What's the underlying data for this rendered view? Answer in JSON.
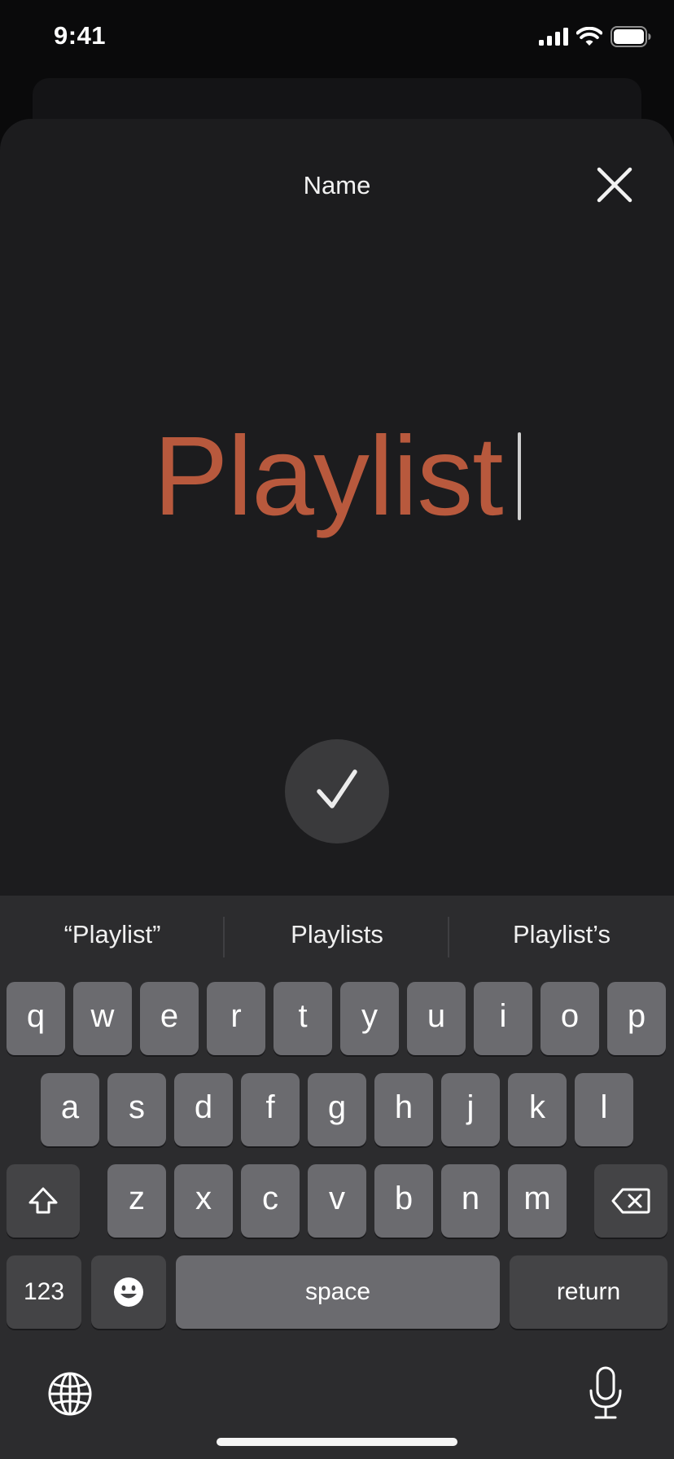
{
  "status_bar": {
    "time": "9:41",
    "icons": [
      "cellular-signal-icon",
      "wifi-icon",
      "battery-icon"
    ]
  },
  "sheet": {
    "title": "Name",
    "close_icon": "close-icon",
    "name_value": "Playlist",
    "confirm_icon": "checkmark-icon"
  },
  "colors": {
    "accent": "#b8593d",
    "sheet_bg": "#1c1c1e",
    "keyboard_bg": "#2c2c2e",
    "key_bg": "#6b6b6f",
    "key_dark_bg": "#444446"
  },
  "keyboard": {
    "suggestions": [
      "“Playlist”",
      "Playlists",
      "Playlist’s"
    ],
    "row1": [
      "q",
      "w",
      "e",
      "r",
      "t",
      "y",
      "u",
      "i",
      "o",
      "p"
    ],
    "row2": [
      "a",
      "s",
      "d",
      "f",
      "g",
      "h",
      "j",
      "k",
      "l"
    ],
    "row3": [
      "z",
      "x",
      "c",
      "v",
      "b",
      "n",
      "m"
    ],
    "numbers_label": "123",
    "space_label": "space",
    "return_label": "return",
    "shift_icon": "shift-icon",
    "delete_icon": "delete-icon",
    "emoji_icon": "emoji-icon",
    "globe_icon": "globe-icon",
    "mic_icon": "microphone-icon"
  }
}
